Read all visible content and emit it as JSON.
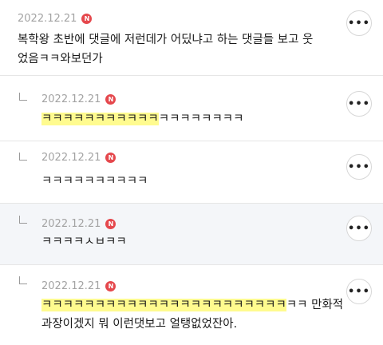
{
  "comments": [
    {
      "date": "2022.12.21",
      "badge": "N",
      "line1": "복학왕 초반에 댓글에 저런데가 어딨냐고 하는 댓글들 보고 웃",
      "line2": "었음ㅋㅋ와보던가"
    },
    {
      "date": "2022.12.21",
      "badge": "N",
      "highlight": "ㅋㅋㅋㅋㅋㅋㅋㅋㅋㅋㅋ",
      "rest": "ㅋㅋㅋㅋㅋㅋㅋㅋ"
    },
    {
      "date": "2022.12.21",
      "badge": "N",
      "text": "ㅋㅋㅋㅋㅋㅋㅋㅋㅋㅋ"
    },
    {
      "date": "2022.12.21",
      "badge": "N",
      "text": "ㅋㅋㅋㅋㅅㅂㅋㅋ"
    },
    {
      "date": "2022.12.21",
      "badge": "N",
      "highlight": "ㅋㅋㅋㅋㅋㅋㅋㅋㅋㅋㅋㅋㅋㅋㅋㅋㅋㅋㅋㅋㅋㅋㅋ",
      "rest": "ㅋㅋ 만화적",
      "line2": "과장이겠지 뭐 이런댓보고 얼탱없었잔아."
    }
  ],
  "more_label": "•••",
  "colors": {
    "highlight": "#fffb8f",
    "badge": "#e5484d",
    "shaded_bg": "#f4f6f9"
  }
}
